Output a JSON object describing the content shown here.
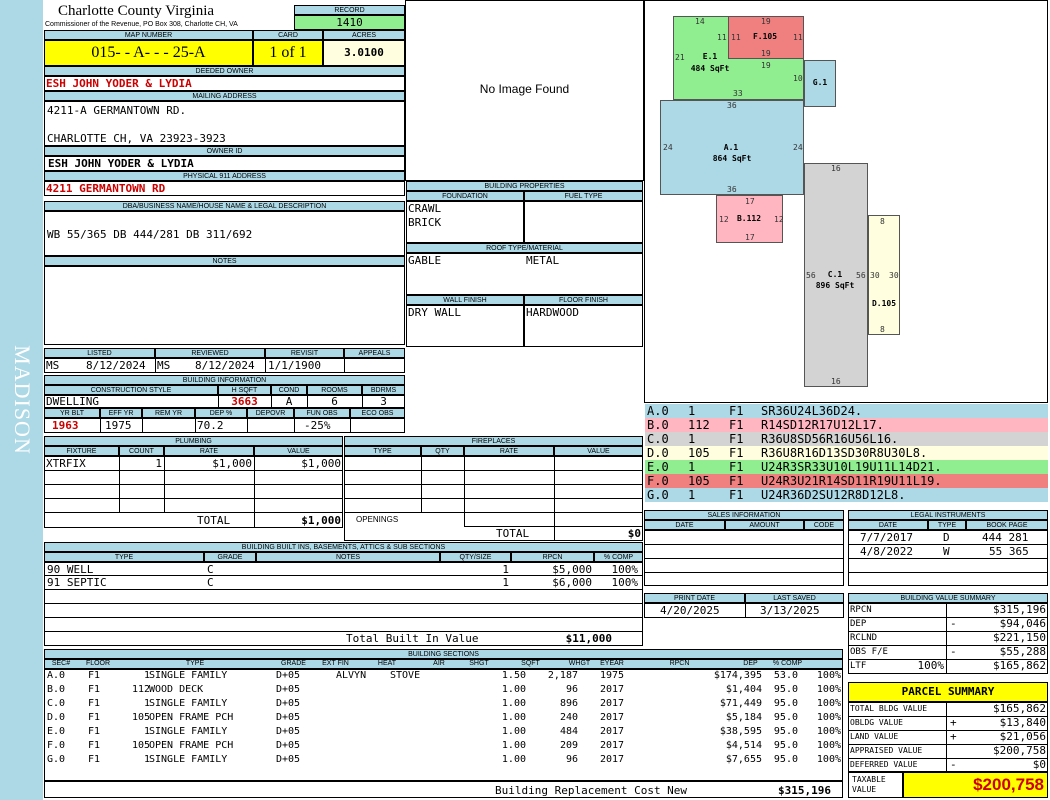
{
  "sidebar": {
    "text": "MADISON"
  },
  "county": {
    "name": "Charlotte County Virginia",
    "address": "Commissioner of the Revenue, PO Box 308, Charlotte CH, VA"
  },
  "record": {
    "label": "RECORD",
    "value": "1410"
  },
  "map": {
    "label": "MAP NUMBER",
    "value": "015- - A- - - 25-A"
  },
  "card": {
    "label": "CARD",
    "value": "1 of 1"
  },
  "acres": {
    "label": "ACRES",
    "value": "3.0100"
  },
  "deeded_owner": {
    "label": "DEEDED OWNER",
    "value": "ESH JOHN YODER & LYDIA"
  },
  "mailing": {
    "label": "MAILING ADDRESS",
    "line1": "4211-A GERMANTOWN RD.",
    "line2": "CHARLOTTE CH, VA 23923-3923"
  },
  "owner_id": {
    "label": "OWNER ID",
    "value": "ESH JOHN YODER & LYDIA"
  },
  "physical": {
    "label": "PHYSICAL 911 ADDRESS",
    "value": "4211 GERMANTOWN RD"
  },
  "dba": {
    "label": "DBA/BUSINESS NAME/HOUSE NAME & LEGAL DESCRIPTION",
    "value": "WB 55/365 DB 444/281 DB 311/692"
  },
  "notes": {
    "label": "NOTES"
  },
  "image": {
    "text": "No Image Found"
  },
  "bldg_props": {
    "label": "BUILDING PROPERTIES",
    "foundation_label": "FOUNDATION",
    "foundation1": "CRAWL",
    "foundation2": "BRICK",
    "fuel_label": "FUEL TYPE",
    "roof_label": "ROOF TYPE/MATERIAL",
    "roof_type": "GABLE",
    "roof_material": "METAL",
    "wall_label": "WALL FINISH",
    "wall": "DRY WALL",
    "floor_label": "FLOOR FINISH",
    "floor": "HARDWOOD"
  },
  "dates": {
    "listed_label": "LISTED",
    "listed_by": "MS",
    "listed": "8/12/2024",
    "reviewed_label": "REVIEWED",
    "reviewed_by": "MS",
    "reviewed": "8/12/2024",
    "revisit_label": "REVISIT",
    "revisit": "1/1/1900",
    "appeals_label": "APPEALS"
  },
  "bldg_info": {
    "label": "BUILDING INFORMATION",
    "style_label": "CONSTRUCTION STYLE",
    "style": "DWELLING",
    "hsqft_label": "H SQFT",
    "hsqft": "3663",
    "cond_label": "COND",
    "cond": "A",
    "rooms_label": "ROOMS",
    "rooms": "6",
    "bdrms_label": "BDRMS",
    "bdrms": "3",
    "yrblt_label": "YR BLT",
    "yrblt": "1963",
    "effyr_label": "EFF YR",
    "effyr": "1975",
    "remyr_label": "REM YR",
    "remyr": "",
    "dep_label": "DEP %",
    "dep": "70.2",
    "depovr_label": "DEPOVR",
    "depovr": "",
    "funobs_label": "FUN OBS",
    "funobs": "-25%",
    "ecoobs_label": "ECO OBS",
    "ecoobs": ""
  },
  "plumbing": {
    "label": "PLUMBING",
    "h_fixture": "FIXTURE",
    "h_count": "COUNT",
    "h_rate": "RATE",
    "h_value": "VALUE",
    "rows": [
      {
        "fixture": "XTRFIX",
        "count": "1",
        "rate": "$1,000",
        "value": "$1,000"
      }
    ],
    "total_label": "TOTAL",
    "total": "$1,000"
  },
  "fireplaces": {
    "label": "FIREPLACES",
    "h_type": "TYPE",
    "h_qty": "QTY",
    "h_rate": "RATE",
    "h_value": "VALUE",
    "openings_label": "OPENINGS",
    "total_label": "TOTAL",
    "total": "$0"
  },
  "builtins": {
    "label": "BUILDING BUILT INS, BASEMENTS, ATTICS & SUB SECTIONS",
    "h_type": "TYPE",
    "h_grade": "GRADE",
    "h_notes": "NOTES",
    "h_qty": "QTY/SIZE",
    "h_rpcn": "RPCN",
    "h_comp": "% COMP",
    "rows": [
      {
        "type": "90 WELL",
        "grade": "C",
        "notes": "",
        "qty": "1",
        "rpcn": "$5,000",
        "comp": "100%"
      },
      {
        "type": "91 SEPTIC",
        "grade": "C",
        "notes": "",
        "qty": "1",
        "rpcn": "$6,000",
        "comp": "100%"
      }
    ],
    "total_label": "Total Built In Value",
    "total": "$11,000"
  },
  "sketch": {
    "shapes": [
      {
        "id": "A.1",
        "sqft": "864 SqFt",
        "color": "#add8e6"
      },
      {
        "id": "B.112",
        "sqft": "",
        "color": "#ffb6c1"
      },
      {
        "id": "C.1",
        "sqft": "896 SqFt",
        "color": "#d3d3d3"
      },
      {
        "id": "D.105",
        "sqft": "",
        "color": "#ffffe0"
      },
      {
        "id": "E.1",
        "sqft": "484 SqFt",
        "color": "#90ee90"
      },
      {
        "id": "F.105",
        "sqft": "",
        "color": "#f08080"
      },
      {
        "id": "G.1",
        "sqft": "",
        "color": "#add8e6"
      }
    ],
    "dims": {
      "a_top": "36",
      "a_left": "24",
      "a_right": "24",
      "a_bottom": "36",
      "b_top": "17",
      "b_left": "12",
      "b_right": "12",
      "b_bottom": "17",
      "c_top": "16",
      "c_left": "56",
      "c_right": "56",
      "c_bottom": "16",
      "d_top": "8",
      "d_left": "30",
      "d_right": "30",
      "d_bottom": "8",
      "e_top": "14",
      "e_left": "21",
      "e_right": "11",
      "e_bottom": "33",
      "e_mid": "19",
      "f_top": "19",
      "f_left": "11",
      "f_right": "11",
      "f_bottom": "19",
      "g_left": "10"
    }
  },
  "vectors": [
    {
      "sec": "A.0",
      "qty": "1",
      "floor": "F1",
      "vec": "SR36U24L36D24.",
      "color": "#add8e6"
    },
    {
      "sec": "B.0",
      "qty": "112",
      "floor": "F1",
      "vec": "R14SD12R17U12L17.",
      "color": "#ffb6c1"
    },
    {
      "sec": "C.0",
      "qty": "1",
      "floor": "F1",
      "vec": "R36U8SD56R16U56L16.",
      "color": "#d3d3d3"
    },
    {
      "sec": "D.0",
      "qty": "105",
      "floor": "F1",
      "vec": "R36U8R16D13SD30R8U30L8.",
      "color": "#ffffe0"
    },
    {
      "sec": "E.0",
      "qty": "1",
      "floor": "F1",
      "vec": "U24R3SR33U10L19U11L14D21.",
      "color": "#90ee90"
    },
    {
      "sec": "F.0",
      "qty": "105",
      "floor": "F1",
      "vec": "U24R3U21R14SD11R19U11L19.",
      "color": "#f08080"
    },
    {
      "sec": "G.0",
      "qty": "1",
      "floor": "F1",
      "vec": "U24R36D2SU12R8D12L8.",
      "color": "#add8e6"
    }
  ],
  "sales": {
    "label": "SALES INFORMATION",
    "h_date": "DATE",
    "h_amount": "AMOUNT",
    "h_code": "CODE"
  },
  "legal": {
    "label": "LEGAL INSTRUMENTS",
    "h_date": "DATE",
    "h_type": "TYPE",
    "h_book": "BOOK PAGE",
    "rows": [
      {
        "date": "7/7/2017",
        "type": "D",
        "book": "444 281"
      },
      {
        "date": "4/8/2022",
        "type": "W",
        "book": "55 365"
      }
    ]
  },
  "print": {
    "print_label": "PRINT DATE",
    "print_date": "4/20/2025",
    "saved_label": "LAST SAVED",
    "saved": "3/13/2025"
  },
  "value_summary": {
    "label": "BUILDING VALUE SUMMARY",
    "rows": [
      {
        "label": "RPCN",
        "sign": "",
        "value": "$315,196"
      },
      {
        "label": "DEP",
        "sign": "-",
        "value": "$94,046"
      },
      {
        "label": "RCLND",
        "sign": "",
        "value": "$221,150"
      },
      {
        "label": "OBS F/E",
        "sign": "-",
        "value": "$55,288"
      },
      {
        "label": "LTF",
        "sign": "100%",
        "value": "$165,862"
      }
    ]
  },
  "parcel": {
    "label": "PARCEL SUMMARY",
    "rows": [
      {
        "label": "TOTAL BLDG VALUE",
        "sign": "",
        "value": "$165,862"
      },
      {
        "label": "OBLDG VALUE",
        "sign": "+",
        "value": "$13,840"
      },
      {
        "label": "LAND VALUE",
        "sign": "+",
        "value": "$21,056"
      },
      {
        "label": "APPRAISED VALUE",
        "sign": "",
        "value": "$200,758"
      },
      {
        "label": "DEFERRED VALUE",
        "sign": "-",
        "value": "$0"
      }
    ],
    "taxable_label1": "TAXABLE",
    "taxable_label2": "VALUE",
    "taxable": "$200,758"
  },
  "sections": {
    "label": "BUILDING SECTIONS",
    "headers": [
      "SEC#",
      "FLOOR",
      "TYPE",
      "GRADE",
      "EXT FIN",
      "HEAT",
      "AIR",
      "SHGT",
      "SQFT",
      "WHGT",
      "EYEAR",
      "RPCN",
      "DEP",
      "% COMP"
    ],
    "rows": [
      {
        "sec": "A.0",
        "floor": "F1",
        "code": "1",
        "type": "SINGLE FAMILY",
        "grade": "D+05",
        "ext": "ALVYN",
        "heat": "STOVE",
        "air": "",
        "shgt": "1.50",
        "sqft": "2,187",
        "whgt": "",
        "eyear": "1975",
        "rpcn": "$174,395",
        "dep": "53.0",
        "comp": "100%"
      },
      {
        "sec": "B.0",
        "floor": "F1",
        "code": "112",
        "type": "WOOD DECK",
        "grade": "D+05",
        "ext": "",
        "heat": "",
        "air": "",
        "shgt": "1.00",
        "sqft": "96",
        "whgt": "",
        "eyear": "2017",
        "rpcn": "$1,404",
        "dep": "95.0",
        "comp": "100%"
      },
      {
        "sec": "C.0",
        "floor": "F1",
        "code": "1",
        "type": "SINGLE FAMILY",
        "grade": "D+05",
        "ext": "",
        "heat": "",
        "air": "",
        "shgt": "1.00",
        "sqft": "896",
        "whgt": "",
        "eyear": "2017",
        "rpcn": "$71,449",
        "dep": "95.0",
        "comp": "100%"
      },
      {
        "sec": "D.0",
        "floor": "F1",
        "code": "105",
        "type": "OPEN FRAME PCH",
        "grade": "D+05",
        "ext": "",
        "heat": "",
        "air": "",
        "shgt": "1.00",
        "sqft": "240",
        "whgt": "",
        "eyear": "2017",
        "rpcn": "$5,184",
        "dep": "95.0",
        "comp": "100%"
      },
      {
        "sec": "E.0",
        "floor": "F1",
        "code": "1",
        "type": "SINGLE FAMILY",
        "grade": "D+05",
        "ext": "",
        "heat": "",
        "air": "",
        "shgt": "1.00",
        "sqft": "484",
        "whgt": "",
        "eyear": "2017",
        "rpcn": "$38,595",
        "dep": "95.0",
        "comp": "100%"
      },
      {
        "sec": "F.0",
        "floor": "F1",
        "code": "105",
        "type": "OPEN FRAME PCH",
        "grade": "D+05",
        "ext": "",
        "heat": "",
        "air": "",
        "shgt": "1.00",
        "sqft": "209",
        "whgt": "",
        "eyear": "2017",
        "rpcn": "$4,514",
        "dep": "95.0",
        "comp": "100%"
      },
      {
        "sec": "G.0",
        "floor": "F1",
        "code": "1",
        "type": "SINGLE FAMILY",
        "grade": "D+05",
        "ext": "",
        "heat": "",
        "air": "",
        "shgt": "1.00",
        "sqft": "96",
        "whgt": "",
        "eyear": "2017",
        "rpcn": "$7,655",
        "dep": "95.0",
        "comp": "100%"
      }
    ],
    "total_label": "Building Replacement Cost New",
    "total": "$315,196"
  }
}
